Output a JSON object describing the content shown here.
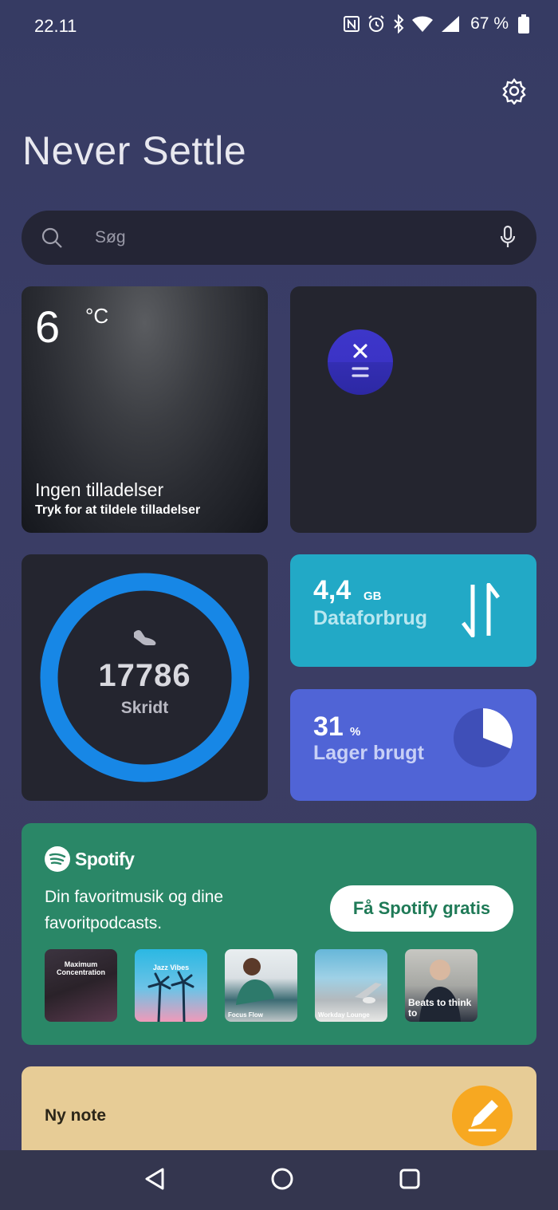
{
  "status_bar": {
    "time": "22.11",
    "battery": "67 %"
  },
  "header": {
    "title": "Never Settle"
  },
  "search": {
    "placeholder": "Søg"
  },
  "weather": {
    "temperature": "6",
    "unit": "°C",
    "title": "Ingen tilladelser",
    "subtitle": "Tryk for at tildele tilladelser"
  },
  "steps": {
    "count": "17786",
    "label": "Skridt"
  },
  "data_usage": {
    "value": "4,4",
    "unit": "GB",
    "label": "Dataforbrug"
  },
  "storage": {
    "value": "31",
    "unit": "%",
    "label": "Lager brugt",
    "fraction_used": 0.31
  },
  "spotify": {
    "brand": "Spotify",
    "description": "Din favoritmusik og dine favoritpodcasts.",
    "cta": "Få Spotify gratis",
    "playlists": [
      "Maximum Concentration",
      "Jazz Vibes",
      "Focus Flow",
      "Workday Lounge",
      "Beats to think to"
    ]
  },
  "note": {
    "label": "Ny note"
  },
  "colors": {
    "data_card": "#22a9c6",
    "storage_card": "#5064d6",
    "spotify_card": "#2a8767",
    "note_card": "#e7cc96",
    "step_ring": "#1787e6"
  }
}
